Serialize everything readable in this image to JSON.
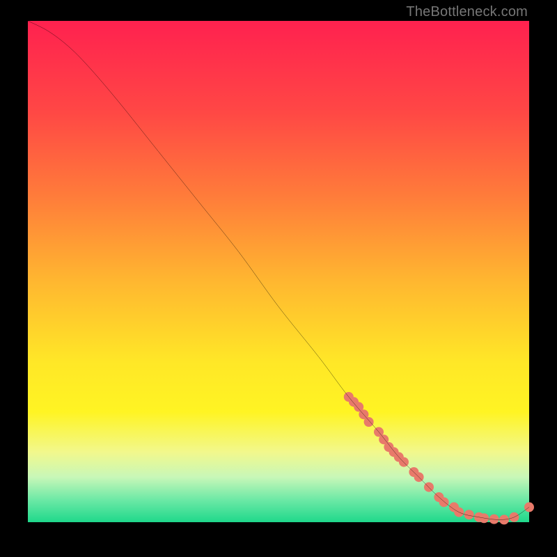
{
  "watermark": "TheBottleneck.com",
  "gradient": {
    "stops": [
      {
        "offset": 0.0,
        "color": "#ff214f"
      },
      {
        "offset": 0.18,
        "color": "#ff4745"
      },
      {
        "offset": 0.35,
        "color": "#ff7c3a"
      },
      {
        "offset": 0.52,
        "color": "#ffb730"
      },
      {
        "offset": 0.68,
        "color": "#ffe727"
      },
      {
        "offset": 0.78,
        "color": "#fff423"
      },
      {
        "offset": 0.86,
        "color": "#f2f88c"
      },
      {
        "offset": 0.91,
        "color": "#c8f7b8"
      },
      {
        "offset": 0.955,
        "color": "#6de9a6"
      },
      {
        "offset": 1.0,
        "color": "#1fd88b"
      }
    ]
  },
  "chart_data": {
    "type": "line",
    "title": "",
    "xlabel": "",
    "ylabel": "",
    "xlim": [
      0,
      100
    ],
    "ylim": [
      0,
      100
    ],
    "grid": false,
    "legend": false,
    "series": [
      {
        "name": "bottleneck-curve",
        "color": "#000000",
        "x": [
          0,
          4,
          8,
          12,
          18,
          26,
          34,
          42,
          50,
          58,
          64,
          70,
          74,
          78,
          82,
          86,
          90,
          94,
          97,
          100
        ],
        "y": [
          100,
          98,
          95,
          91,
          84,
          74,
          64,
          54,
          43,
          33,
          25,
          18,
          13,
          9,
          5,
          2,
          1,
          0.5,
          1,
          3
        ]
      }
    ],
    "markers": {
      "name": "highlight-dots",
      "color": "#e87a6a",
      "radius_px": 7,
      "x": [
        64,
        65,
        66,
        67,
        68,
        70,
        71,
        72,
        73,
        74,
        75,
        77,
        78,
        80,
        82,
        83,
        85,
        86,
        88,
        90,
        91,
        93,
        95,
        97,
        100
      ],
      "y": [
        25,
        24,
        23,
        21.5,
        20,
        18,
        16.5,
        15,
        14,
        13,
        12,
        10,
        9,
        7,
        5,
        4,
        3,
        2,
        1.5,
        1,
        0.8,
        0.6,
        0.5,
        1,
        3
      ]
    }
  }
}
